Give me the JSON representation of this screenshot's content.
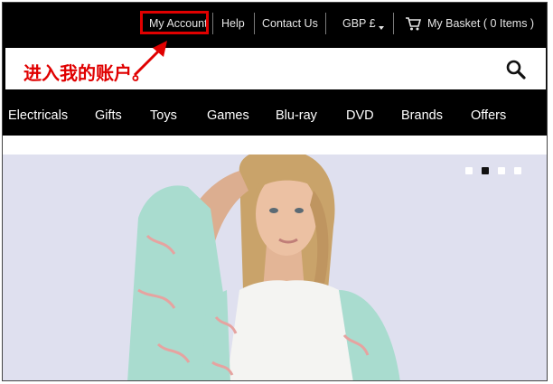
{
  "topbar": {
    "my_account": "My Account",
    "help": "Help",
    "contact_us": "Contact Us",
    "currency": "GBP £",
    "basket": "My Basket ( 0 Items )"
  },
  "annotation": {
    "text": "进入我的账户。",
    "color": "#e00000"
  },
  "search": {
    "icon": "search-icon"
  },
  "nav": {
    "items": [
      "Electricals",
      "Gifts",
      "Toys",
      "Games",
      "Blu-ray",
      "DVD",
      "Brands",
      "Offers"
    ]
  },
  "carousel": {
    "slide_count": 4,
    "active_index": 1
  },
  "colors": {
    "bar": "#000000",
    "highlight": "#e00000",
    "hero_bg": "#dfe0ef"
  }
}
